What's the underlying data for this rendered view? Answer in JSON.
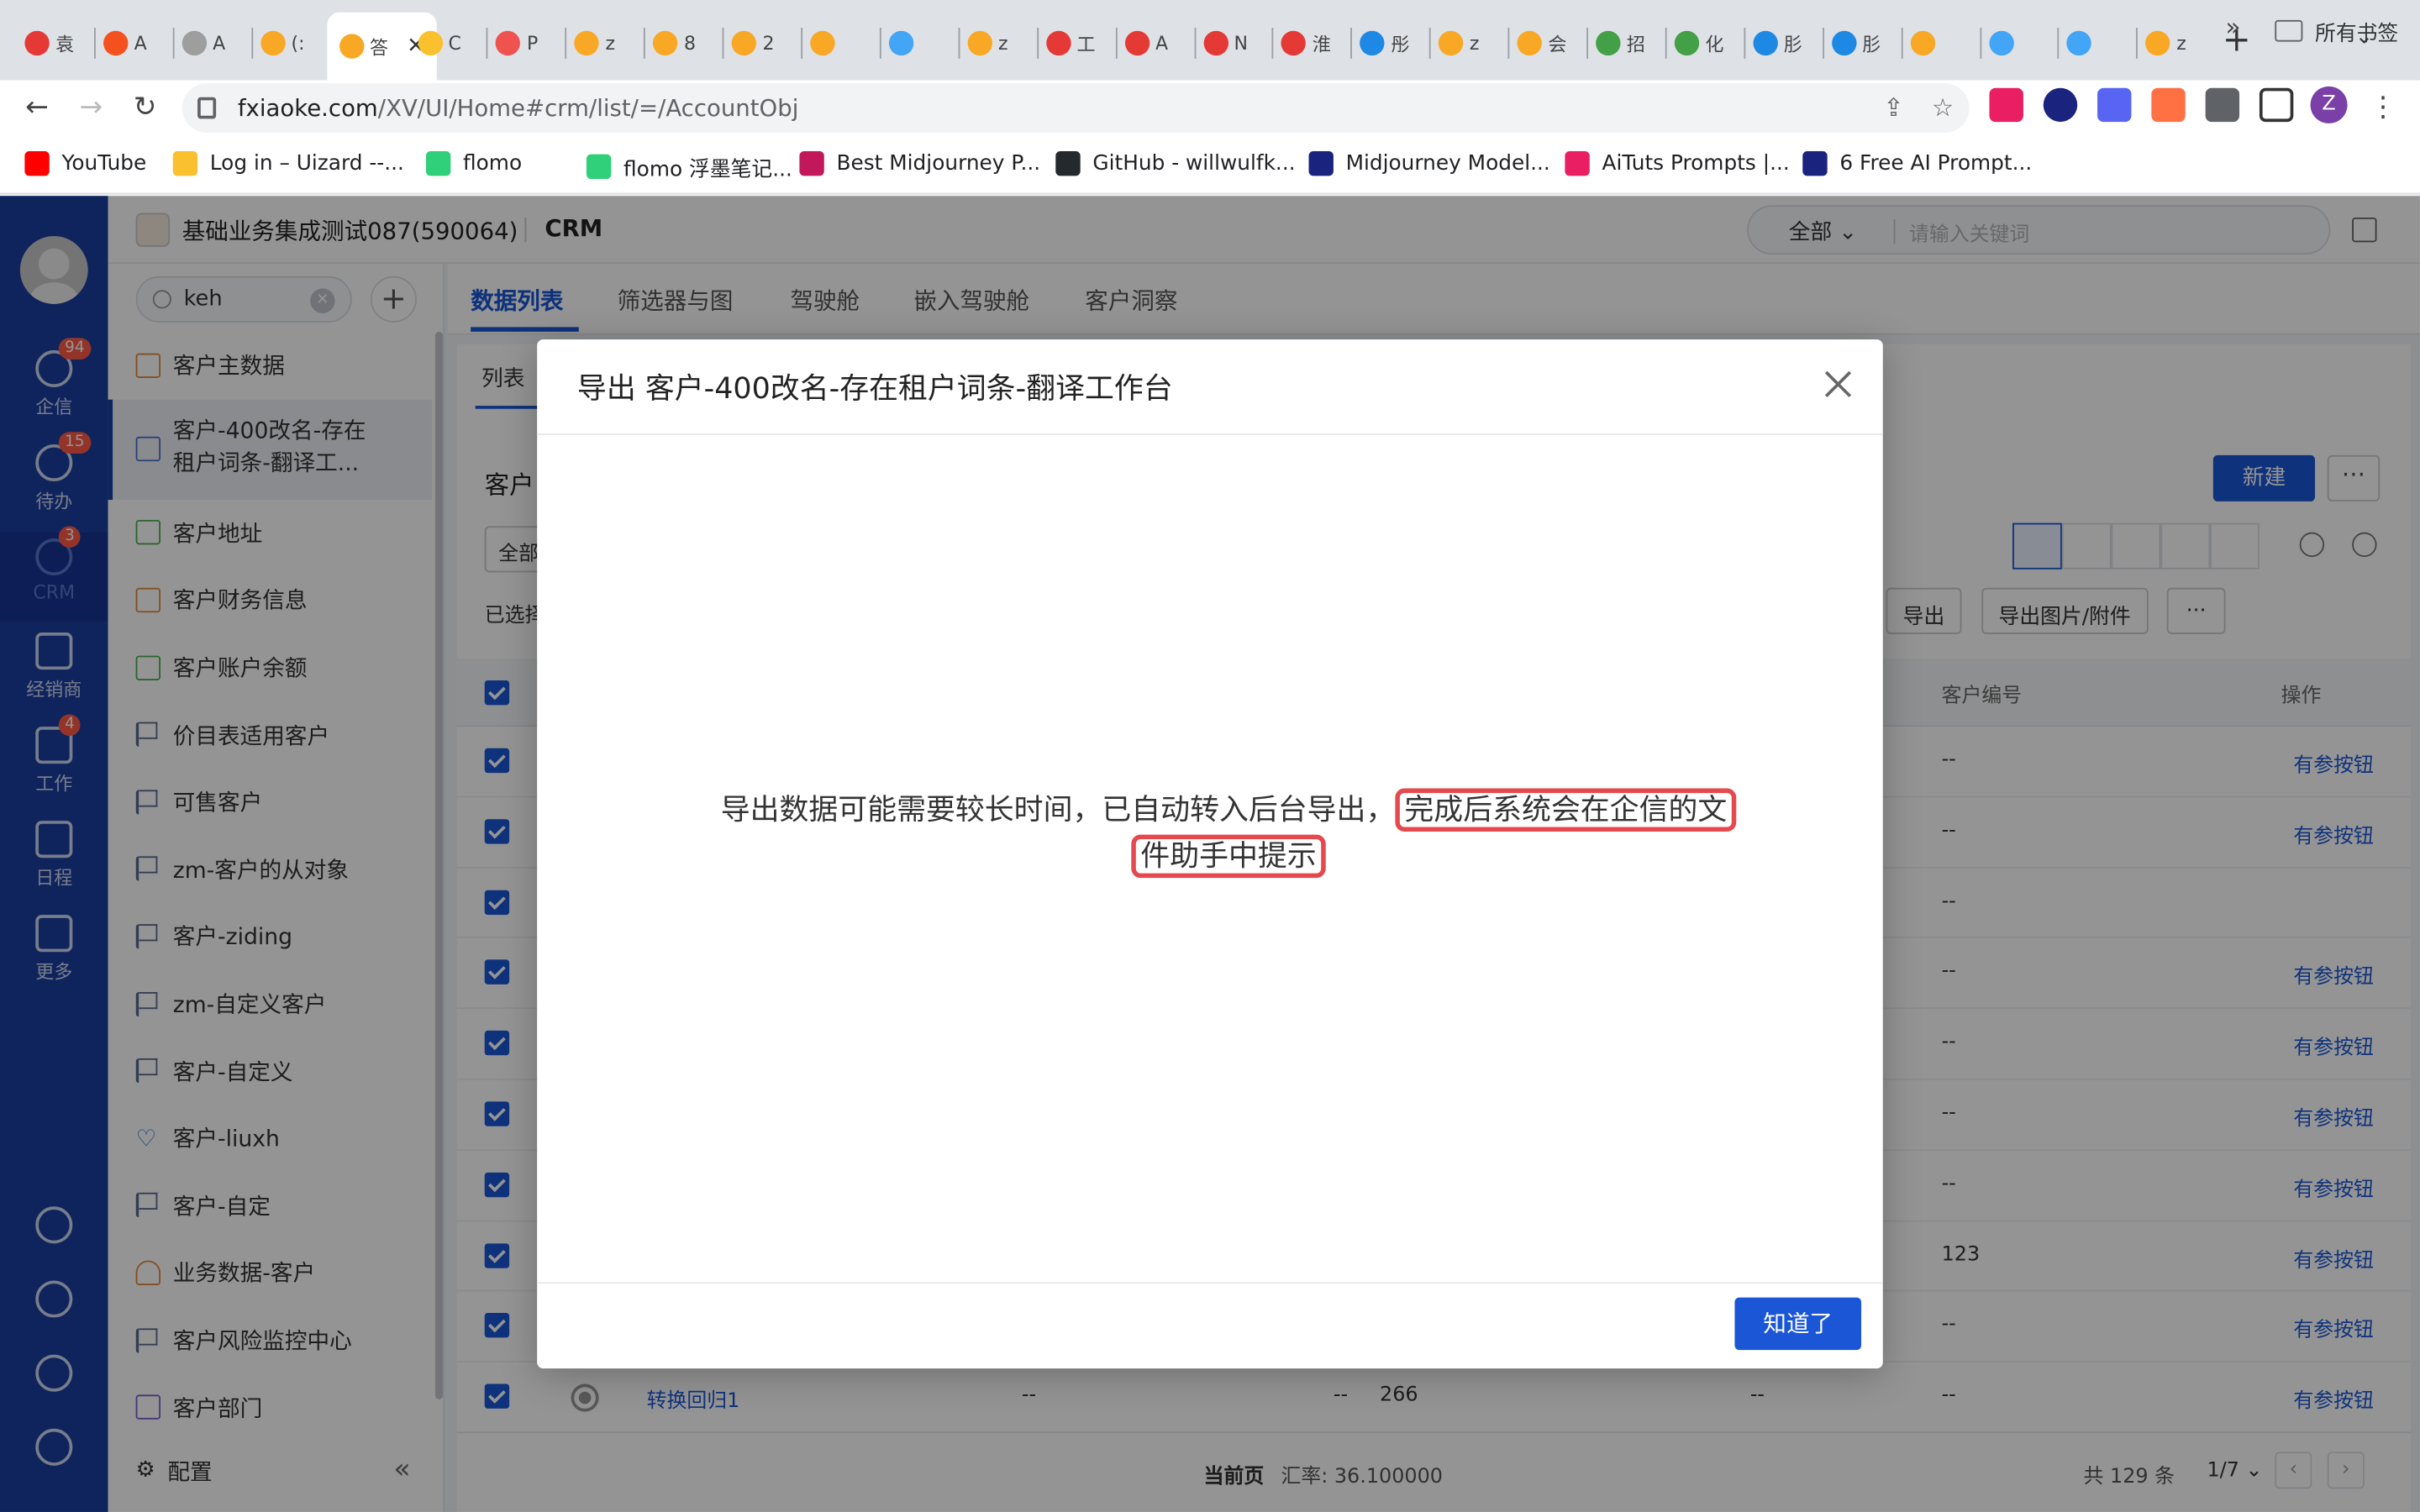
{
  "browser": {
    "tabs": [
      {
        "title": "袁",
        "color": "#e53935"
      },
      {
        "title": "A",
        "color": "#f4511e"
      },
      {
        "title": "A",
        "color": "#9e9e9e"
      },
      {
        "title": "(:",
        "color": "#f9a825"
      },
      {
        "title": "答",
        "color": "#f9a825",
        "active": true
      },
      {
        "title": "C",
        "color": "#fbc02d"
      },
      {
        "title": "P",
        "color": "#ef5350"
      },
      {
        "title": "z",
        "color": "#f9a825"
      },
      {
        "title": "8",
        "color": "#f9a825"
      },
      {
        "title": "2",
        "color": "#f9a825"
      },
      {
        "title": "",
        "color": "#f9a825"
      },
      {
        "title": "",
        "color": "#42a5f5"
      },
      {
        "title": "z",
        "color": "#f9a825"
      },
      {
        "title": "工",
        "color": "#e53935"
      },
      {
        "title": "A",
        "color": "#e53935"
      },
      {
        "title": "N",
        "color": "#e53935"
      },
      {
        "title": "淮",
        "color": "#e53935"
      },
      {
        "title": "彤",
        "color": "#1e88e5"
      },
      {
        "title": "z",
        "color": "#f9a825"
      },
      {
        "title": "会",
        "color": "#f9a825"
      },
      {
        "title": "招",
        "color": "#43a047"
      },
      {
        "title": "化",
        "color": "#43a047"
      },
      {
        "title": "肜",
        "color": "#1e88e5"
      },
      {
        "title": "肜",
        "color": "#1e88e5"
      },
      {
        "title": "",
        "color": "#f9a825"
      },
      {
        "title": "",
        "color": "#42a5f5"
      },
      {
        "title": "",
        "color": "#42a5f5"
      },
      {
        "title": "z",
        "color": "#f9a825"
      }
    ],
    "url_host": "fxiaoke.com",
    "url_path": "/XV/UI/Home#crm/list/=/AccountObj",
    "bookmarks": [
      {
        "label": "YouTube",
        "color": "#ff0000"
      },
      {
        "label": "Log in – Uizard --...",
        "color": "#fbc02d"
      },
      {
        "label": "flomo",
        "color": "#30cf79"
      },
      {
        "label": "flomo 浮墨笔记...",
        "color": "#30cf79"
      },
      {
        "label": "Best Midjourney P...",
        "color": "#c2185b"
      },
      {
        "label": "GitHub - willwulfk...",
        "color": "#24292e"
      },
      {
        "label": "Midjourney Model...",
        "color": "#1a237e"
      },
      {
        "label": "AiTuts Prompts |...",
        "color": "#e91e63"
      },
      {
        "label": "6 Free AI Prompt...",
        "color": "#1a237e"
      }
    ],
    "bookmarks_more": "»",
    "all_bookmarks": "所有书签"
  },
  "rail": {
    "items": [
      {
        "label": "企信",
        "badge": "94"
      },
      {
        "label": "待办",
        "badge": "15"
      },
      {
        "label": "CRM",
        "badge": "3"
      },
      {
        "label": "经销商",
        "badge": ""
      },
      {
        "label": "工作",
        "badge": "4"
      },
      {
        "label": "日程",
        "badge": ""
      },
      {
        "label": "更多",
        "badge": ""
      }
    ]
  },
  "header": {
    "company": "基础业务集成测试087(590064)",
    "module": "CRM",
    "search_scope": "全部",
    "search_placeholder": "请输入关键词"
  },
  "sidebar": {
    "search_value": "keh",
    "items": [
      {
        "label": "客户主数据",
        "style": "orange"
      },
      {
        "label": "客户-400改名-存在\n租户词条-翻译工...",
        "style": "blue",
        "selected": true
      },
      {
        "label": "客户地址",
        "style": "green"
      },
      {
        "label": "客户财务信息",
        "style": "orange"
      },
      {
        "label": "客户账户余额",
        "style": "green"
      },
      {
        "label": "价目表适用客户",
        "style": "flag"
      },
      {
        "label": "可售客户",
        "style": "flag"
      },
      {
        "label": "zm-客户的从对象",
        "style": "flag"
      },
      {
        "label": "客户-ziding",
        "style": "flag"
      },
      {
        "label": "zm-自定义客户",
        "style": "flag"
      },
      {
        "label": "客户-自定义",
        "style": "flag"
      },
      {
        "label": "客户-liuxh",
        "style": "heart"
      },
      {
        "label": "客户-自定",
        "style": "flag"
      },
      {
        "label": "业务数据-客户",
        "style": "person"
      },
      {
        "label": "客户风险监控中心",
        "style": "flag"
      },
      {
        "label": "客户部门",
        "style": "purple"
      }
    ],
    "footer_label": "配置"
  },
  "main": {
    "tabs": [
      "数据列表",
      "筛选器与图",
      "驾驶舱",
      "嵌入驾驶舱",
      "客户洞察"
    ],
    "subtab": "列表",
    "object_title": "客户",
    "new_button": "新建",
    "scope": "全部",
    "selected_text": "已选择",
    "export_button": "导出",
    "export_attach_button": "导出图片/附件",
    "columns": {
      "customer_no": "客户编号",
      "action": "操作"
    },
    "rows": [
      {
        "no": "--",
        "action": "有参按钮"
      },
      {
        "no": "--",
        "action": "有参按钮"
      },
      {
        "no": "--",
        "action": ""
      },
      {
        "no": "--",
        "action": "有参按钮"
      },
      {
        "no": "--",
        "action": "有参按钮"
      },
      {
        "no": "--",
        "action": "有参按钮"
      },
      {
        "no": "--",
        "action": "有参按钮"
      },
      {
        "no": "123",
        "action": "有参按钮"
      },
      {
        "no": "--",
        "action": "有参按钮"
      },
      {
        "no": "--",
        "action": "有参按钮",
        "name": "转换回归1",
        "c2": "--",
        "c3": "--",
        "c4": "266",
        "c5": "--"
      }
    ],
    "footer": {
      "current_page": "当前页",
      "rate": "汇率: 36.100000",
      "total": "共 129 条",
      "page": "1/7"
    }
  },
  "modal": {
    "title": "导出 客户-400改名-存在租户词条-翻译工作台",
    "message_plain": "导出数据可能需要较长时间，已自动转入后台导出，",
    "message_highlight_1": "完成后系统会在企信的文",
    "message_highlight_2": "件助手中提示",
    "ok_button": "知道了",
    "highlight_color": "#e5484d"
  }
}
